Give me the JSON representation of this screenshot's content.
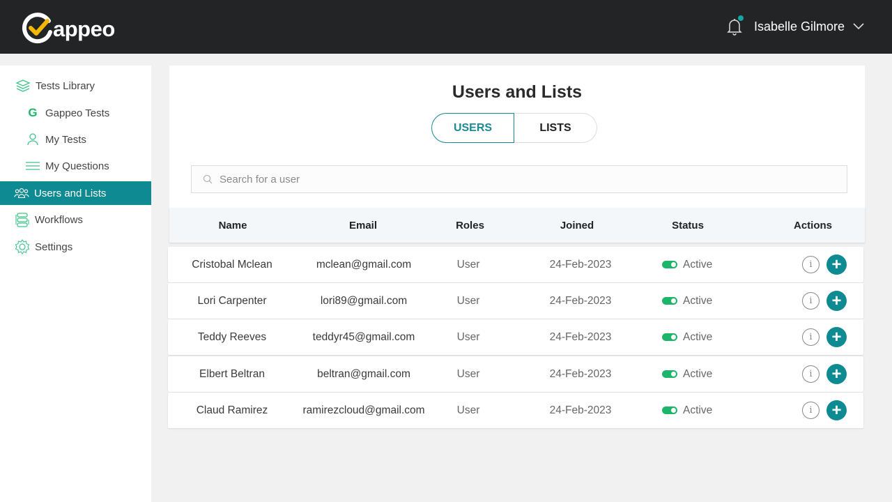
{
  "app": {
    "brand": "appeo",
    "brand_initial": "G"
  },
  "header": {
    "user_name": "Isabelle Gilmore",
    "notification_dot": true
  },
  "sidebar": {
    "items": [
      {
        "label": "Tests Library",
        "icon": "layers-icon",
        "active": false
      },
      {
        "label": "Gappeo Tests",
        "icon": "g-logo-icon",
        "active": false
      },
      {
        "label": "My Tests",
        "icon": "user-icon",
        "active": false
      },
      {
        "label": "My Questions",
        "icon": "lines-icon",
        "active": false
      },
      {
        "label": "Users and Lists",
        "icon": "users-icon",
        "active": true
      },
      {
        "label": "Workflows",
        "icon": "workflow-icon",
        "active": false
      },
      {
        "label": "Settings",
        "icon": "gear-icon",
        "active": false
      }
    ]
  },
  "main": {
    "title": "Users and Lists",
    "tabs": [
      {
        "label": "USERS",
        "active": true
      },
      {
        "label": "LISTS",
        "active": false
      }
    ],
    "search": {
      "placeholder": "Search for a user",
      "value": ""
    },
    "table": {
      "columns": [
        "Name",
        "Email",
        "Roles",
        "Joined",
        "Status",
        "Actions"
      ],
      "rows": [
        {
          "name": "Cristobal Mclean",
          "email": "mclean@gmail.com",
          "role": "User",
          "joined": "24-Feb-2023",
          "status": "Active"
        },
        {
          "name": "Lori Carpenter",
          "email": "lori89@gmail.com",
          "role": "User",
          "joined": "24-Feb-2023",
          "status": "Active"
        },
        {
          "name": "Teddy Reeves",
          "email": "teddyr45@gmail.com",
          "role": "User",
          "joined": "24-Feb-2023",
          "status": "Active"
        },
        {
          "name": "Elbert Beltran",
          "email": "beltran@gmail.com",
          "role": "User",
          "joined": "24-Feb-2023",
          "status": "Active"
        },
        {
          "name": "Claud Ramirez",
          "email": "ramirezcloud@gmail.com",
          "role": "User",
          "joined": "24-Feb-2023",
          "status": "Active"
        }
      ]
    }
  },
  "colors": {
    "accent": "#0e8a92",
    "active_status": "#1cb56a",
    "logo_check": "#f5b800",
    "header_bg": "#222426"
  }
}
